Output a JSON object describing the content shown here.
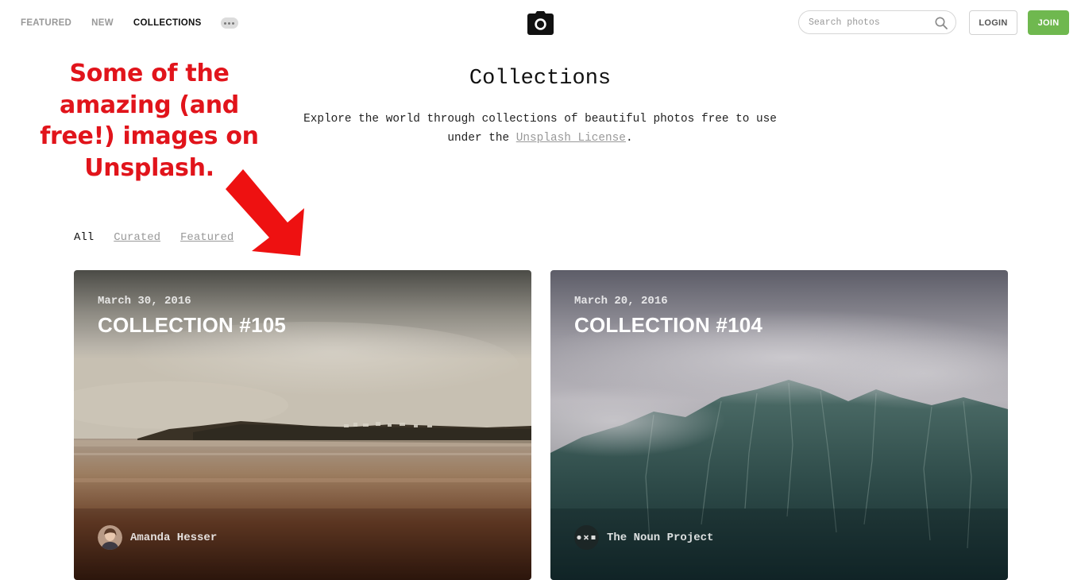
{
  "nav": {
    "links": [
      {
        "label": "FEATURED",
        "active": false
      },
      {
        "label": "NEW",
        "active": false
      },
      {
        "label": "COLLECTIONS",
        "active": true
      }
    ],
    "more_icon": "more-dots-icon",
    "logo_icon": "camera-icon"
  },
  "search": {
    "placeholder": "Search photos",
    "value": "",
    "icon": "search-icon"
  },
  "auth": {
    "login_label": "LOGIN",
    "join_label": "JOIN",
    "join_color": "#6fb84f"
  },
  "header": {
    "title": "Collections",
    "description_before": "Explore the world through collections of beautiful photos free to use under the ",
    "license_link": "Unsplash License",
    "description_after": "."
  },
  "annotation": {
    "text": "Some of the amazing (and free!) images on Unsplash.",
    "color": "#e1141b",
    "arrow_icon": "arrow-down-right-icon"
  },
  "filters": [
    {
      "label": "All",
      "active": true
    },
    {
      "label": "Curated",
      "active": false
    },
    {
      "label": "Featured",
      "active": false
    }
  ],
  "collections": [
    {
      "date": "March 30, 2016",
      "title": "COLLECTION #105",
      "author": "Amanda Hesser",
      "avatar": "user-photo-avatar"
    },
    {
      "date": "March 20, 2016",
      "title": "COLLECTION #104",
      "author": "The Noun Project",
      "avatar": "noun-project-logo"
    }
  ]
}
